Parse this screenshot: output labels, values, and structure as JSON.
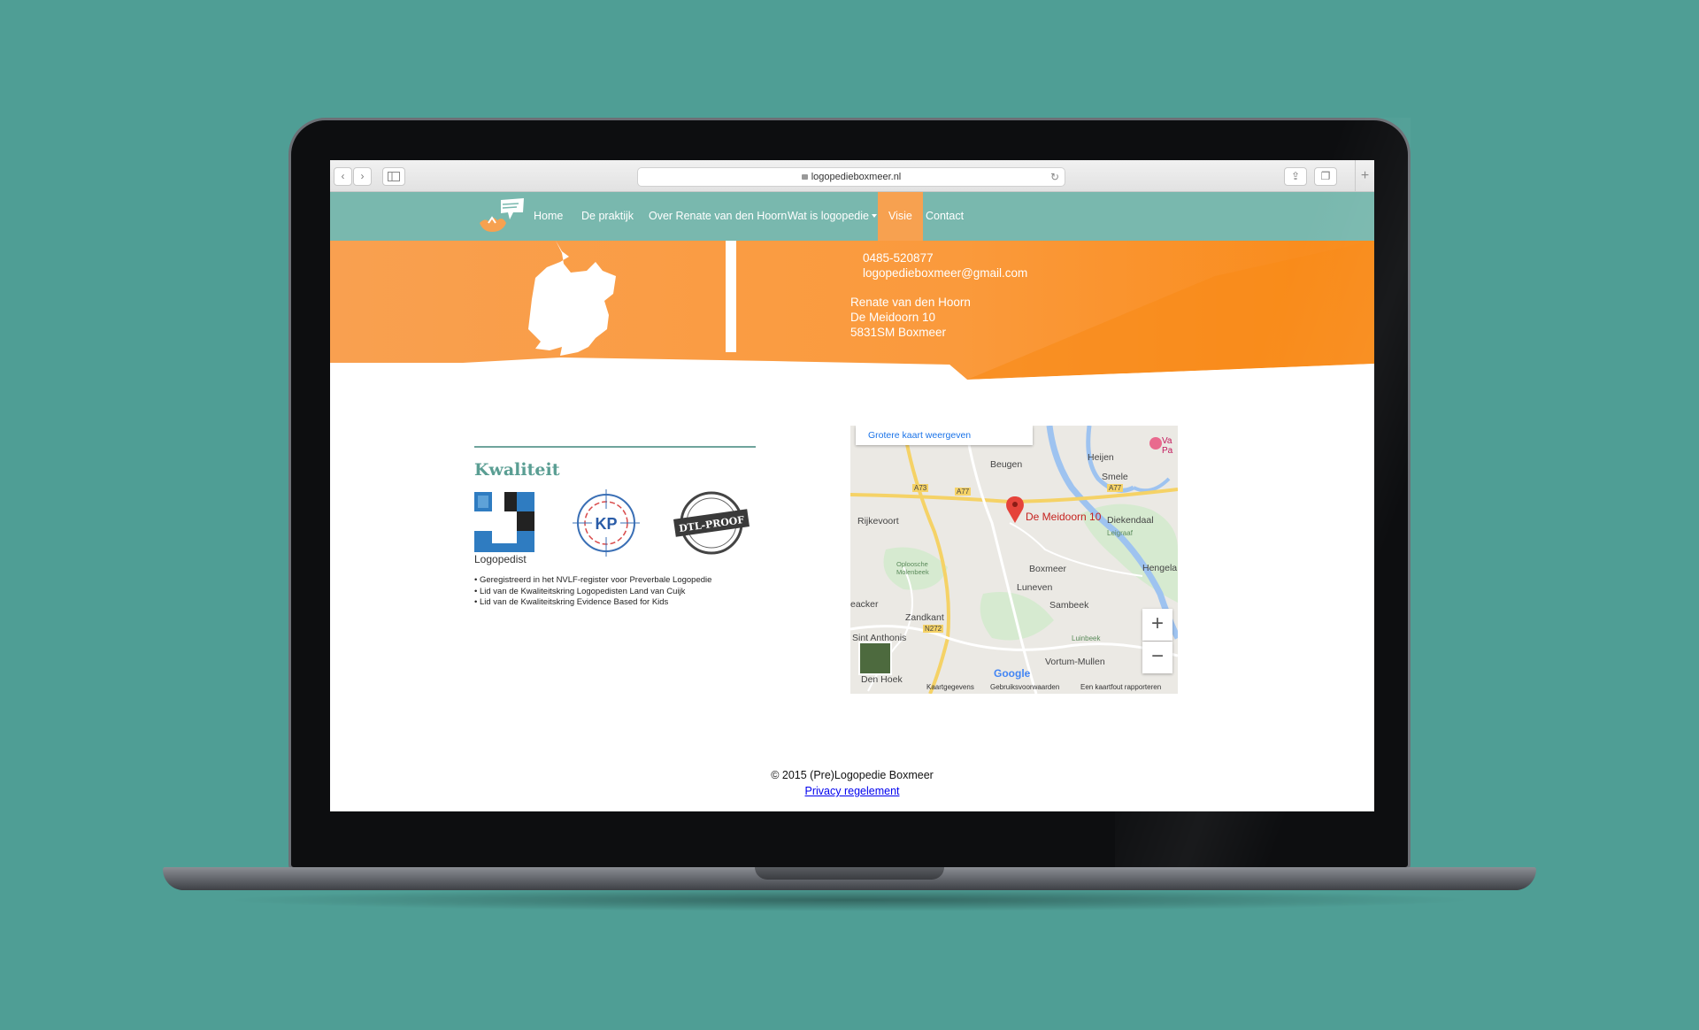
{
  "browser": {
    "url": "logopedieboxmeer.nl",
    "back_icon": "chevron-left-icon",
    "forward_icon": "chevron-right-icon",
    "sidebar_icon": "sidebar-icon",
    "reload_icon": "reload-icon",
    "share_icon": "share-icon",
    "tabs_icon": "tabs-icon",
    "new_tab_label": "+"
  },
  "nav": {
    "items": [
      {
        "label": "Home"
      },
      {
        "label": "De praktijk"
      },
      {
        "label": "Over Renate van den Hoorn"
      },
      {
        "label": "Wat is logopedie"
      },
      {
        "label": "Visie"
      },
      {
        "label": "Contact"
      }
    ],
    "active_index": 4
  },
  "contact": {
    "phone": "0485-520877",
    "email": "logopedieboxmeer@gmail.com",
    "name": "Renate van den Hoorn",
    "street": "De Meidoorn 10",
    "city": "5831SM Boxmeer"
  },
  "quality": {
    "title": "Kwaliteit",
    "badge_label": "Logopedist",
    "kp_text": "KP",
    "dtl_text": "DTL-PROOF",
    "bullets": [
      "• Geregistreerd in het NVLF-register voor Preverbale Logopedie",
      "• Lid van de Kwaliteitskring Logopedisten Land van Cuijk",
      "• Lid van de Kwaliteitskring Evidence Based for Kids"
    ]
  },
  "map": {
    "larger_map_label": "Grotere kaart weergeven",
    "pin_label": "De Meidoorn 10",
    "places": [
      "Heijen",
      "Beugen",
      "Smele",
      "Rijkevoort",
      "Diekendaal",
      "Boxmeer",
      "Hengela",
      "Luneven",
      "Sambeek",
      "Zandkant",
      "Sint Anthonis",
      "Vortum-Mullen",
      "Den Hoek",
      "Oploosche Molenbeek",
      "Luinbeek",
      "Leigraaf",
      "eacker",
      "Va Pa"
    ],
    "roads": [
      "A73",
      "A77",
      "A77",
      "N272"
    ],
    "zoom_in": "+",
    "zoom_out": "−",
    "google": "Google",
    "footer": [
      "Kaartgegevens",
      "Gebruiksvoorwaarden",
      "Een kaartfout rapporteren"
    ]
  },
  "footer": {
    "copyright": "© 2015 (Pre)Logopedie Boxmeer",
    "privacy": "Privacy regelement"
  },
  "colors": {
    "background": "#4f9e95",
    "nav": "#79b8ae",
    "accent_orange": "#f7a150",
    "dark_orange": "#f98a18",
    "teal_text": "#5a9e93"
  }
}
